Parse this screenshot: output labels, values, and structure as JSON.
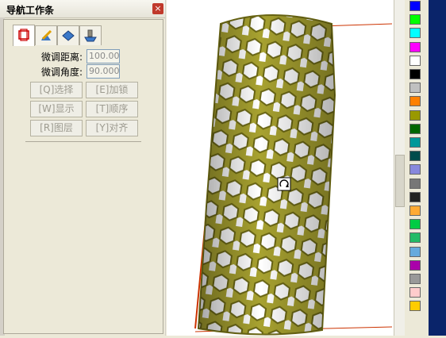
{
  "window": {
    "title": "导航工作条",
    "close": "×"
  },
  "tabs": [
    {
      "name": "tab-select",
      "icon": "cube-select-icon"
    },
    {
      "name": "tab-edit",
      "icon": "pencil-edit-icon"
    },
    {
      "name": "tab-view",
      "icon": "diamond-view-icon"
    },
    {
      "name": "tab-layer",
      "icon": "layer-tool-icon"
    }
  ],
  "fine_tune": {
    "distance_label": "微调距离:",
    "distance_value": "100.00",
    "angle_label": "微调角度:",
    "angle_value": "90.000"
  },
  "buttons": {
    "select": "[Q]选择",
    "lock": "[E]加锁",
    "show": "[W]显示",
    "order": "[T]顺序",
    "layer": "[R]图层",
    "align": "[Y]对齐"
  },
  "palette": [
    "#0000ff",
    "#00ff00",
    "#00ffff",
    "#ff00ff",
    "#ffffff",
    "#000000",
    "#c0c0c0",
    "#ff8000",
    "#999900",
    "#006600",
    "#009999",
    "#004c4c",
    "#8888dd",
    "#777777",
    "#222222",
    "#ffaa33",
    "#00cc44",
    "#22bb66",
    "#66aadd",
    "#aa00aa",
    "#999999",
    "#ffcccc",
    "#ffcc00"
  ],
  "colors": {
    "tube_fill": "#a8a230",
    "tube_dark": "#6a6614",
    "frame_line": "#cc3300"
  }
}
